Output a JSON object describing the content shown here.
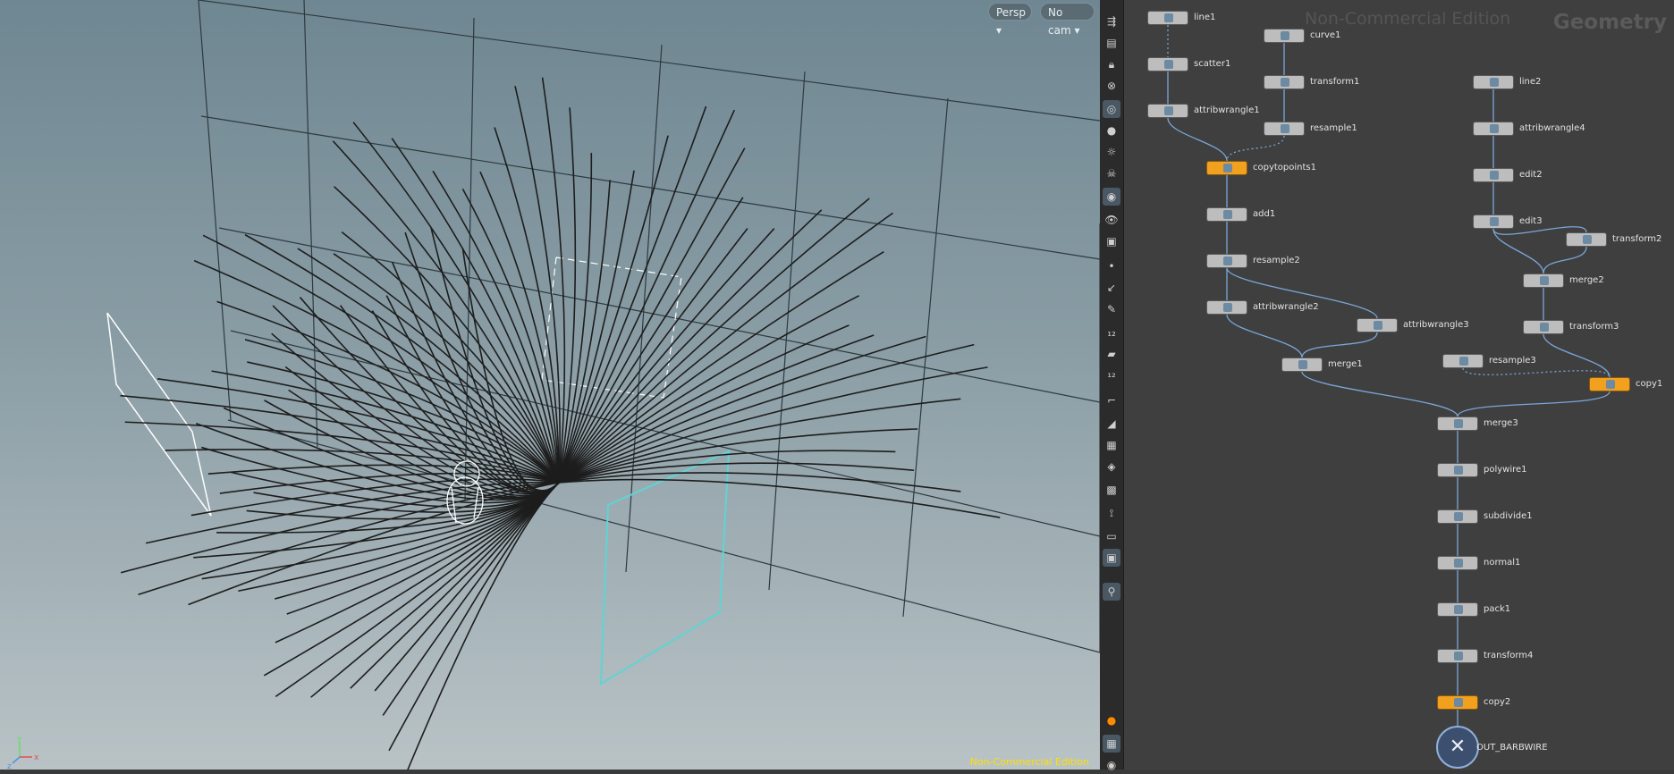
{
  "viewport": {
    "camera_mode": "Persp",
    "camera": "No cam",
    "watermark": "Non-Commercial Edition",
    "axis_labels": [
      "y",
      "z",
      "x"
    ]
  },
  "toolstrip": {
    "icons": [
      "display-options-icon",
      "ghost-icon",
      "lock-icon",
      "close-icon",
      "light-icon",
      "bulb-icon",
      "bulb-alt-icon",
      "skull-icon",
      "camera-icon",
      "eye-icon",
      "bucket-icon",
      "point-icon",
      "arrow-icon",
      "pen-icon",
      "number-12-icon",
      "brush-icon",
      "number-12-alt-icon",
      "corner-icon",
      "bird-icon",
      "grid-tex-icon",
      "layers-icon",
      "map-icon",
      "hook-icon",
      "panel-icon",
      "snapshot-icon",
      "pin-icon"
    ],
    "bottom_icons": [
      "warning-icon",
      "grid-icon",
      "eye-icon"
    ]
  },
  "network": {
    "watermark": "Non-Commercial Edition",
    "context": "Geometry",
    "nodes": [
      {
        "name": "line1",
        "type": "normal"
      },
      {
        "name": "curve1",
        "type": "normal"
      },
      {
        "name": "scatter1",
        "type": "normal"
      },
      {
        "name": "transform1",
        "type": "normal"
      },
      {
        "name": "line2",
        "type": "normal"
      },
      {
        "name": "attribwrangle1",
        "type": "normal"
      },
      {
        "name": "resample1",
        "type": "normal"
      },
      {
        "name": "attribwrangle4",
        "type": "normal"
      },
      {
        "name": "copytopoints1",
        "type": "orange"
      },
      {
        "name": "edit2",
        "type": "normal"
      },
      {
        "name": "add1",
        "type": "normal"
      },
      {
        "name": "edit3",
        "type": "normal"
      },
      {
        "name": "transform2",
        "type": "normal"
      },
      {
        "name": "resample2",
        "type": "normal"
      },
      {
        "name": "merge2",
        "type": "normal"
      },
      {
        "name": "attribwrangle2",
        "type": "normal"
      },
      {
        "name": "attribwrangle3",
        "type": "normal"
      },
      {
        "name": "transform3",
        "type": "normal"
      },
      {
        "name": "resample3",
        "type": "normal"
      },
      {
        "name": "merge1",
        "type": "normal"
      },
      {
        "name": "copy1",
        "type": "orange"
      },
      {
        "name": "merge3",
        "type": "normal"
      },
      {
        "name": "polywire1",
        "type": "normal"
      },
      {
        "name": "subdivide1",
        "type": "normal"
      },
      {
        "name": "normal1",
        "type": "normal"
      },
      {
        "name": "pack1",
        "type": "normal"
      },
      {
        "name": "transform4",
        "type": "normal"
      },
      {
        "name": "copy2",
        "type": "orange"
      },
      {
        "name": "OUT_BARBWIRE",
        "type": "output"
      }
    ]
  }
}
